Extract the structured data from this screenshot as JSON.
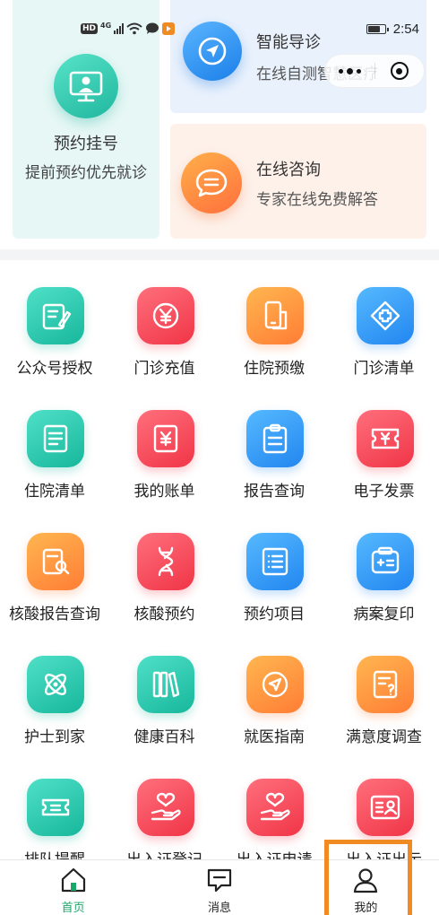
{
  "status_bar": {
    "hd_badge": "HD",
    "network": "4G",
    "time": "2:54",
    "icons": [
      "wifi-icon",
      "chat-bubble-icon",
      "video-app-icon",
      "battery-icon"
    ]
  },
  "mini_program_capsule": {
    "icons": [
      "more-dots-icon",
      "close-target-icon"
    ]
  },
  "top_cards": {
    "appointment": {
      "title": "预约挂号",
      "subtitle": "提前预约优先就诊",
      "icon": "doctor-monitor-icon",
      "color": "#1fb79e"
    },
    "guide": {
      "title": "智能导诊",
      "subtitle": "在线自测智慧医疗",
      "icon": "navigation-arrow-icon",
      "color": "#1b7fe8"
    },
    "consult": {
      "title": "在线咨询",
      "subtitle": "专家在线免费解答",
      "icon": "chat-bubble-icon",
      "color": "#ff6f3c"
    }
  },
  "services": [
    {
      "label": "公众号授权",
      "icon": "authorize-edit-icon",
      "color": "teal"
    },
    {
      "label": "门诊充值",
      "icon": "yen-coin-icon",
      "color": "red"
    },
    {
      "label": "住院预缴",
      "icon": "phone-payment-icon",
      "color": "orange"
    },
    {
      "label": "门诊清单",
      "icon": "medical-cross-icon",
      "color": "blue"
    },
    {
      "label": "住院清单",
      "icon": "document-list-icon",
      "color": "teal"
    },
    {
      "label": "我的账单",
      "icon": "yen-bill-icon",
      "color": "red"
    },
    {
      "label": "报告查询",
      "icon": "clipboard-report-icon",
      "color": "blue"
    },
    {
      "label": "电子发票",
      "icon": "invoice-icon",
      "color": "red"
    },
    {
      "label": "核酸报告查询",
      "icon": "report-search-icon",
      "color": "orange"
    },
    {
      "label": "核酸预约",
      "icon": "dna-icon",
      "color": "red"
    },
    {
      "label": "预约项目",
      "icon": "list-items-icon",
      "color": "blue"
    },
    {
      "label": "病案复印",
      "icon": "medical-record-icon",
      "color": "blue"
    },
    {
      "label": "护士到家",
      "icon": "atom-care-icon",
      "color": "teal"
    },
    {
      "label": "健康百科",
      "icon": "books-icon",
      "color": "teal"
    },
    {
      "label": "就医指南",
      "icon": "compass-guide-icon",
      "color": "orange"
    },
    {
      "label": "满意度调查",
      "icon": "survey-icon",
      "color": "orange"
    },
    {
      "label": "排队提醒",
      "icon": "queue-ticket-icon",
      "color": "teal"
    },
    {
      "label": "出入证登记",
      "icon": "hand-heart-icon",
      "color": "red"
    },
    {
      "label": "出入证申请",
      "icon": "hand-heart-icon",
      "color": "red"
    },
    {
      "label": "出入证出示",
      "icon": "id-card-icon",
      "color": "red"
    }
  ],
  "bottom_nav": [
    {
      "label": "首页",
      "icon": "home-icon",
      "active": true
    },
    {
      "label": "消息",
      "icon": "message-icon",
      "active": false
    },
    {
      "label": "我的",
      "icon": "user-icon",
      "active": false
    }
  ],
  "colors": {
    "active_tab": "#1aa86a",
    "highlight_box": "#f08a22"
  }
}
